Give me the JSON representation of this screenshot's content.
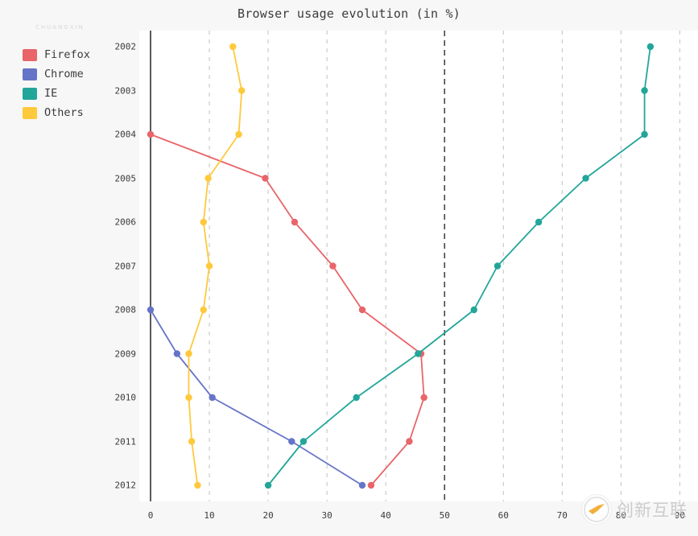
{
  "chart_data": {
    "type": "line",
    "title": "Browser usage evolution (in %)",
    "orientation": "horizontal",
    "xlabel": "",
    "ylabel": "",
    "xlim": [
      0,
      92
    ],
    "ylim": [
      2002,
      2012
    ],
    "grid": true,
    "grid_axis": "x",
    "emphasized_gridline": 50,
    "legend_position": "left-outside",
    "x_ticks": [
      0,
      10,
      20,
      30,
      40,
      50,
      60,
      70,
      80,
      90
    ],
    "x_tick_labels": [
      "0",
      "10",
      "20",
      "30",
      "40",
      "50",
      "60",
      "70",
      "80",
      "90"
    ],
    "categories": [
      2002,
      2003,
      2004,
      2005,
      2006,
      2007,
      2008,
      2009,
      2010,
      2011,
      2012
    ],
    "y_tick_labels": [
      "2002",
      "2003",
      "2004",
      "2005",
      "2006",
      "2007",
      "2008",
      "2009",
      "2010",
      "2011",
      "2012"
    ],
    "series": [
      {
        "name": "Firefox",
        "color": "#e8656a",
        "x": [
          null,
          null,
          0,
          19.5,
          24.5,
          31,
          36,
          46,
          46.5,
          44,
          37.5
        ],
        "values": [
          null,
          null,
          0,
          19.5,
          24.5,
          31,
          36,
          46,
          46.5,
          44,
          37.5
        ]
      },
      {
        "name": "Chrome",
        "color": "#6674c8",
        "x": [
          null,
          null,
          null,
          null,
          null,
          null,
          0,
          4.5,
          10.5,
          24,
          36
        ],
        "values": [
          null,
          null,
          null,
          null,
          null,
          null,
          0,
          4.5,
          10.5,
          24,
          36
        ]
      },
      {
        "name": "IE",
        "color": "#22a699",
        "x": [
          85,
          84,
          84,
          74,
          66,
          59,
          55,
          45.5,
          35,
          26,
          20
        ],
        "values": [
          85,
          84,
          84,
          74,
          66,
          59,
          55,
          45.5,
          35,
          26,
          20
        ]
      },
      {
        "name": "Others",
        "color": "#ffc93c",
        "x": [
          14,
          15.5,
          15,
          9.8,
          9,
          10,
          9,
          6.5,
          6.5,
          7,
          8
        ],
        "values": [
          14,
          15.5,
          15,
          9.8,
          9,
          10,
          9,
          6.5,
          6.5,
          7,
          8
        ]
      }
    ]
  },
  "legend": {
    "items": [
      {
        "label": "Firefox",
        "color": "#e8656a"
      },
      {
        "label": "Chrome",
        "color": "#6674c8"
      },
      {
        "label": "IE",
        "color": "#22a699"
      },
      {
        "label": "Others",
        "color": "#ffc93c"
      }
    ]
  },
  "watermark": {
    "text": "创新互联",
    "subtext": "CHUANGXIN"
  },
  "colors": {
    "page_background": "#f7f7f7",
    "plot_background": "#ffffff",
    "axis": "#2f3136",
    "grid": "#b8b8b8",
    "grid_emphasis": "#3d3d3d",
    "text": "#3b3b3b"
  }
}
